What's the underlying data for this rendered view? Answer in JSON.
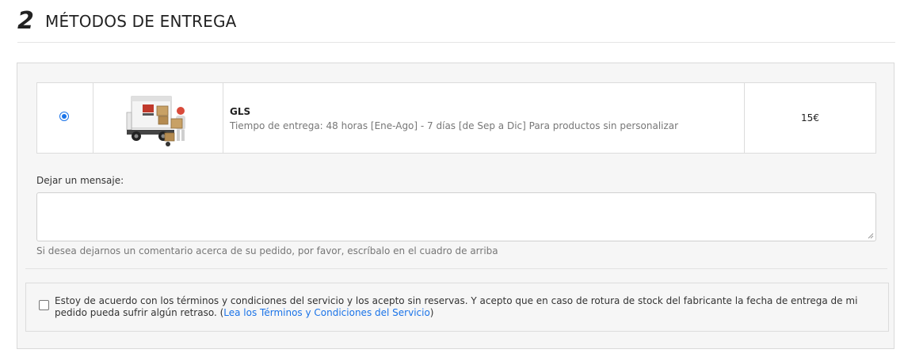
{
  "section": {
    "step_number": "2",
    "title": "MÉTODOS DE ENTREGA"
  },
  "carrier": {
    "selected": true,
    "logo_icon": "delivery-truck-with-boxes",
    "name": "GLS",
    "delay": "Tiempo de entrega: 48 horas [Ene-Ago] - 7 días [de Sep a Dic] Para productos sin personalizar",
    "price": "15€"
  },
  "message": {
    "label": "Dejar un mensaje:",
    "value": "",
    "help": "Si desea dejarnos un comentario acerca de su pedido, por favor, escríbalo en el cuadro de arriba"
  },
  "terms": {
    "checked": false,
    "text": "Estoy de acuerdo con los términos y condiciones del servicio y los acepto sin reservas. Y acepto que en caso de rotura de stock del fabricante la fecha de entrega de mi pedido pueda sufrir algún retraso. (",
    "link_text": "Lea los Términos y Condiciones del Servicio",
    "text_after": ")"
  },
  "colors": {
    "accent": "#1a73e8",
    "panel_bg": "#f6f6f6"
  }
}
